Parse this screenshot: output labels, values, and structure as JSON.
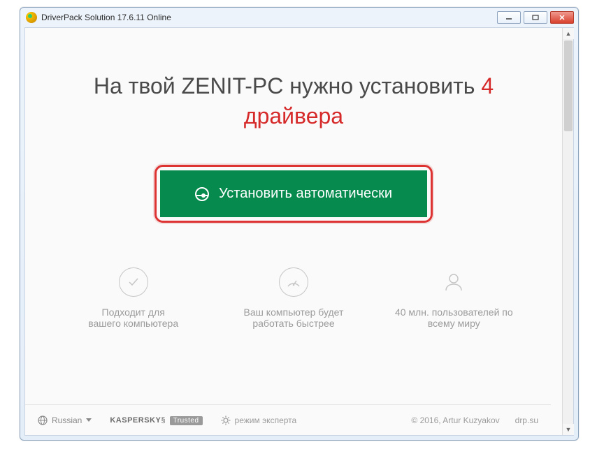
{
  "window": {
    "title": "DriverPack Solution 17.6.11 Online"
  },
  "headline": {
    "prefix": "На твой ",
    "pc_name": "ZENIT-PC",
    "mid": " нужно установить ",
    "count": "4",
    "drivers_word": "драйвера"
  },
  "cta": {
    "label": "Установить автоматически"
  },
  "features": [
    {
      "line1": "Подходит для",
      "line2": "вашего компьютера"
    },
    {
      "line1": "Ваш компьютер будет",
      "line2": "работать быстрее"
    },
    {
      "line1": "40 млн. пользователей по",
      "line2": "всему миру"
    }
  ],
  "footer": {
    "language": "Russian",
    "kaspersky": "KASPERSKY",
    "kaspersky_badge": "Trusted",
    "expert_mode": "режим эксперта",
    "copyright": "© 2016, Artur Kuzyakov",
    "site": "drp.su"
  }
}
